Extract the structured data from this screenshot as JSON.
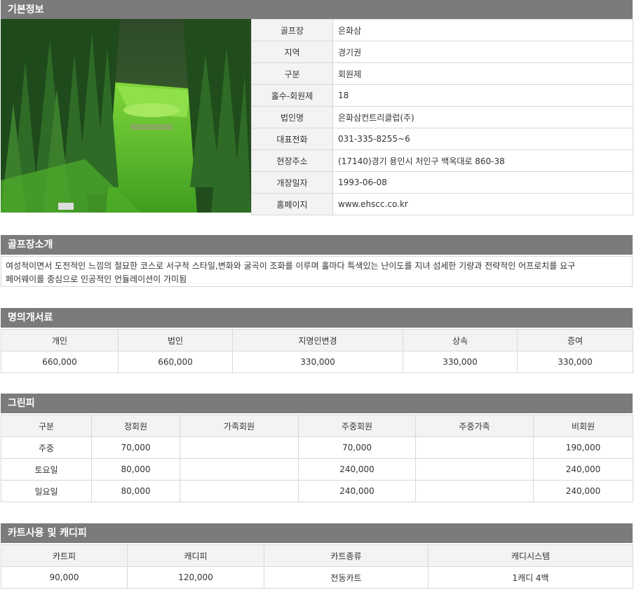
{
  "basic": {
    "header": "기본정보",
    "rows": [
      {
        "label": "골프장",
        "value": "은화삼"
      },
      {
        "label": "지역",
        "value": "경기권"
      },
      {
        "label": "구분",
        "value": "회원제"
      },
      {
        "label": "홀수-회원제",
        "value": "18"
      },
      {
        "label": "법인명",
        "value": "은화삼컨트리클럽(주)"
      },
      {
        "label": "대표전화",
        "value": "031-335-8255~6"
      },
      {
        "label": "현장주소",
        "value": "(17140)경기 용인시 처인구 백옥대로 860-38"
      },
      {
        "label": "개장일자",
        "value": "1993-06-08"
      },
      {
        "label": "홈페이지",
        "value": "www.ehscc.co.kr"
      }
    ]
  },
  "intro": {
    "header": "골프장소개",
    "line1": "여성적이면서 도전적인 느낌의 절묘한 코스로 서구적 스타일,변화와 굴곡이 조화를 이루며 홀마다 특색있는 난이도를 지녀 섬세한 기량과 전략적인 어프로치를 요구",
    "line2": "페어웨이를 중심으로 인공적인 언듈레이션이 가미됨"
  },
  "transfer": {
    "header": "명의개서료",
    "columns": [
      "개인",
      "법인",
      "지명인변경",
      "상속",
      "증여"
    ],
    "values": [
      "660,000",
      "660,000",
      "330,000",
      "330,000",
      "330,000"
    ]
  },
  "greenfee": {
    "header": "그린피",
    "columns": [
      "구분",
      "정회원",
      "가족회원",
      "주중회원",
      "주중가족",
      "비회원"
    ],
    "rows": [
      [
        "주중",
        "70,000",
        "",
        "70,000",
        "",
        "190,000"
      ],
      [
        "토요일",
        "80,000",
        "",
        "240,000",
        "",
        "240,000"
      ],
      [
        "일요일",
        "80,000",
        "",
        "240,000",
        "",
        "240,000"
      ]
    ]
  },
  "cart": {
    "header": "카트사용 및 캐디피",
    "columns": [
      "카트피",
      "캐디피",
      "카트종류",
      "캐디시스템"
    ],
    "values": [
      "90,000",
      "120,000",
      "전동카트",
      "1캐디 4백"
    ]
  },
  "colors": {
    "header_bg": "#7b7b7b",
    "th_bg": "#f3f3f3",
    "border": "#d8d8d8",
    "fairway": "#4fae2a"
  }
}
